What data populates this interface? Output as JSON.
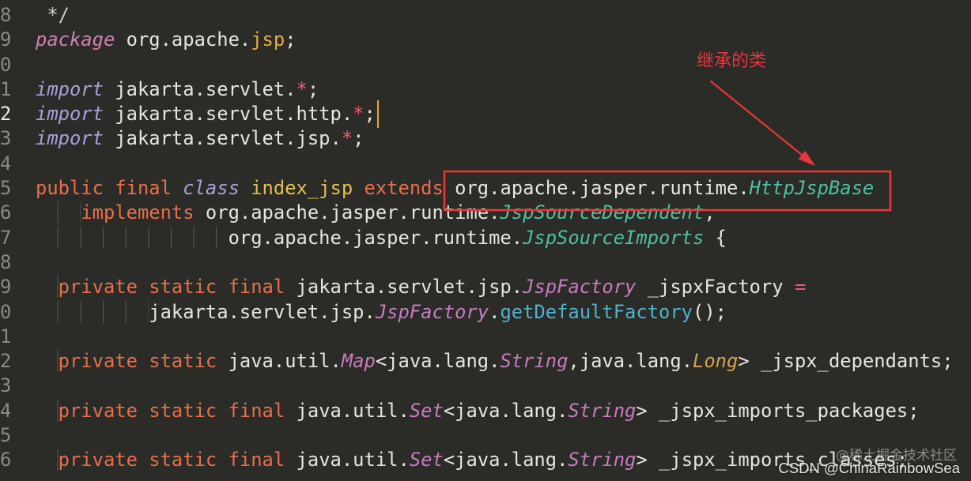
{
  "editor": {
    "theme": {
      "background": "#2b2b27",
      "text": "#e6e6e0",
      "line_number": "#8b8b84",
      "line_number_current": "#ecece6",
      "indent_guide": "#5c5c56",
      "cursor": "#f2a33a"
    },
    "lines": [
      {
        "num": "8",
        "tokens": [
          {
            "t": " */",
            "c": "#cfcfc8"
          }
        ]
      },
      {
        "num": "9",
        "tokens": [
          {
            "t": "package",
            "c": "#d27fb3",
            "i": true
          },
          {
            "t": " org.apache."
          },
          {
            "t": "jsp",
            "c": "#e6ad48"
          },
          {
            "t": ";"
          }
        ]
      },
      {
        "num": "0",
        "tokens": []
      },
      {
        "num": "1",
        "tokens": [
          {
            "t": "import",
            "c": "#a8a0d8",
            "i": true
          },
          {
            "t": " jakarta.servlet."
          },
          {
            "t": "*",
            "c": "#ee5a6e"
          },
          {
            "t": ";"
          }
        ]
      },
      {
        "num": "2",
        "current": true,
        "tokens": [
          {
            "t": "import",
            "c": "#a8a0d8",
            "i": true
          },
          {
            "t": " jakarta.servlet.http."
          },
          {
            "t": "*",
            "c": "#ee5a6e"
          },
          {
            "t": ";"
          }
        ]
      },
      {
        "num": "3",
        "tokens": [
          {
            "t": "import",
            "c": "#a8a0d8",
            "i": true
          },
          {
            "t": " jakarta.servlet.jsp."
          },
          {
            "t": "*",
            "c": "#ee5a6e"
          },
          {
            "t": ";"
          }
        ]
      },
      {
        "num": "4",
        "tokens": []
      },
      {
        "num": "5",
        "tokens": [
          {
            "t": "public",
            "c": "#e86f4a"
          },
          {
            "t": " "
          },
          {
            "t": "final",
            "c": "#e86f4a"
          },
          {
            "t": " "
          },
          {
            "t": "class",
            "c": "#a8a0d8",
            "i": true
          },
          {
            "t": " "
          },
          {
            "t": "index_jsp",
            "c": "#e2c050"
          },
          {
            "t": " "
          },
          {
            "t": "extends",
            "c": "#e86f4a"
          },
          {
            "t": " org.apache.jasper.runtime."
          },
          {
            "t": "HttpJspBase",
            "c": "#4fbfa3",
            "i": true
          }
        ]
      },
      {
        "num": "6",
        "tokens": [
          {
            "t": "    ",
            "ws": true
          },
          {
            "t": "implements",
            "c": "#e86f4a"
          },
          {
            "t": " org.apache.jasper.runtime."
          },
          {
            "t": "JspSourceDependent",
            "c": "#4fbfa3",
            "i": true
          },
          {
            "t": ","
          }
        ]
      },
      {
        "num": "7",
        "tokens": [
          {
            "t": "                 ",
            "ws": true
          },
          {
            "t": "org.apache.jasper.runtime."
          },
          {
            "t": "JspSourceImports",
            "c": "#4fbfa3",
            "i": true
          },
          {
            "t": " {"
          }
        ]
      },
      {
        "num": "8",
        "tokens": []
      },
      {
        "num": "9",
        "tokens": [
          {
            "t": "  ",
            "ws": true
          },
          {
            "t": "private",
            "c": "#e86f4a"
          },
          {
            "t": " "
          },
          {
            "t": "static",
            "c": "#e86f4a"
          },
          {
            "t": " "
          },
          {
            "t": "final",
            "c": "#e86f4a"
          },
          {
            "t": " jakarta.servlet.jsp."
          },
          {
            "t": "JspFactory",
            "c": "#c97ac0",
            "i": true
          },
          {
            "t": " _jspxFactory "
          },
          {
            "t": "=",
            "c": "#ee5a6e"
          }
        ]
      },
      {
        "num": "0",
        "tokens": [
          {
            "t": "          ",
            "ws": true
          },
          {
            "t": "jakarta.servlet.jsp."
          },
          {
            "t": "JspFactory",
            "c": "#c97ac0",
            "i": true
          },
          {
            "t": "."
          },
          {
            "t": "getDefaultFactory",
            "c": "#4db3d0"
          },
          {
            "t": "();"
          }
        ]
      },
      {
        "num": "1",
        "tokens": []
      },
      {
        "num": "2",
        "tokens": [
          {
            "t": "  ",
            "ws": true
          },
          {
            "t": "private",
            "c": "#e86f4a"
          },
          {
            "t": " "
          },
          {
            "t": "static",
            "c": "#e86f4a"
          },
          {
            "t": " java.util."
          },
          {
            "t": "Map",
            "c": "#c97ac0",
            "i": true
          },
          {
            "t": "<java.lang."
          },
          {
            "t": "String",
            "c": "#c97ac0",
            "i": true
          },
          {
            "t": ",java.lang."
          },
          {
            "t": "Long",
            "c": "#d6a34e",
            "i": true
          },
          {
            "t": "> _jspx_dependants;"
          }
        ]
      },
      {
        "num": "3",
        "tokens": []
      },
      {
        "num": "4",
        "tokens": [
          {
            "t": "  ",
            "ws": true
          },
          {
            "t": "private",
            "c": "#e86f4a"
          },
          {
            "t": " "
          },
          {
            "t": "static",
            "c": "#e86f4a"
          },
          {
            "t": " "
          },
          {
            "t": "final",
            "c": "#e86f4a"
          },
          {
            "t": " java.util."
          },
          {
            "t": "Set",
            "c": "#c97ac0",
            "i": true
          },
          {
            "t": "<java.lang."
          },
          {
            "t": "String",
            "c": "#c97ac0",
            "i": true
          },
          {
            "t": "> _jspx_imports_packages;"
          }
        ]
      },
      {
        "num": "5",
        "tokens": []
      },
      {
        "num": "6",
        "tokens": [
          {
            "t": "  ",
            "ws": true
          },
          {
            "t": "private",
            "c": "#e86f4a"
          },
          {
            "t": " "
          },
          {
            "t": "static",
            "c": "#e86f4a"
          },
          {
            "t": " "
          },
          {
            "t": "final",
            "c": "#e86f4a"
          },
          {
            "t": " java.util."
          },
          {
            "t": "Set",
            "c": "#c97ac0",
            "i": true
          },
          {
            "t": "<java.lang."
          },
          {
            "t": "String",
            "c": "#c97ac0",
            "i": true
          },
          {
            "t": "> _jspx_imports_classes;"
          }
        ]
      }
    ]
  },
  "annotation": {
    "label": "继承的类",
    "color": "#e6383a"
  },
  "watermarks": {
    "juejin": "@稀土掘金技术社区",
    "csdn": "CSDN @ChinaRainbowSea"
  }
}
